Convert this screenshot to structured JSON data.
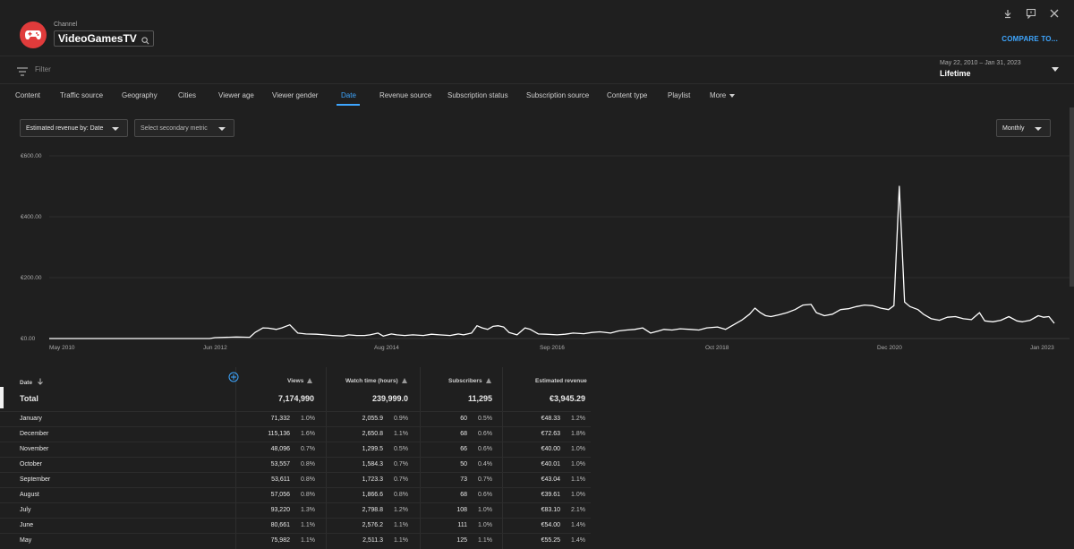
{
  "header": {
    "channel_caption": "Channel",
    "channel_name": "VideoGamesTV",
    "compare_label": "COMPARE TO...",
    "icons": [
      "download-icon",
      "feedback-icon",
      "close-icon",
      "search-icon"
    ]
  },
  "filter": {
    "placeholder": "Filter",
    "date_range": "May 22, 2010 – Jan 31, 2023",
    "date_label": "Lifetime"
  },
  "tabs": [
    {
      "label": "Content"
    },
    {
      "label": "Traffic source"
    },
    {
      "label": "Geography"
    },
    {
      "label": "Cities"
    },
    {
      "label": "Viewer age"
    },
    {
      "label": "Viewer gender"
    },
    {
      "label": "Date",
      "active": true
    },
    {
      "label": "Revenue source"
    },
    {
      "label": "Subscription status"
    },
    {
      "label": "Subscription source"
    },
    {
      "label": "Content type"
    },
    {
      "label": "Playlist"
    },
    {
      "label": "More"
    }
  ],
  "controls": {
    "metric_select": "Estimated revenue by: Date",
    "secondary_select": "Select secondary metric",
    "interval_select": "Monthly"
  },
  "chart_data": {
    "type": "line",
    "ylim": [
      0,
      600
    ],
    "y_ticks": [
      "€600.00",
      "€400.00",
      "€200.00",
      "€0.00"
    ],
    "x_ticks": [
      "May 2010",
      "Jun 2012",
      "Aug 2014",
      "Sep 2016",
      "Oct 2018",
      "Dec 2020",
      "Jan 2023"
    ],
    "grid": true,
    "colors": {
      "line": "#ffffff",
      "grid": "#3a3a3a"
    },
    "points": [
      [
        0,
        0
      ],
      [
        50,
        0
      ],
      [
        60,
        0
      ],
      [
        62,
        3
      ],
      [
        70,
        5
      ],
      [
        75,
        4
      ],
      [
        77,
        20
      ],
      [
        80,
        35
      ],
      [
        82,
        34
      ],
      [
        85,
        30
      ],
      [
        87,
        35
      ],
      [
        90,
        45
      ],
      [
        93,
        18
      ],
      [
        96,
        15
      ],
      [
        100,
        14
      ],
      [
        103,
        12
      ],
      [
        106,
        10
      ],
      [
        110,
        8
      ],
      [
        112,
        12
      ],
      [
        115,
        10
      ],
      [
        118,
        10
      ],
      [
        120,
        12
      ],
      [
        123,
        18
      ],
      [
        125,
        8
      ],
      [
        128,
        15
      ],
      [
        130,
        12
      ],
      [
        133,
        10
      ],
      [
        136,
        12
      ],
      [
        140,
        10
      ],
      [
        143,
        14
      ],
      [
        146,
        12
      ],
      [
        150,
        10
      ],
      [
        153,
        15
      ],
      [
        155,
        12
      ],
      [
        158,
        18
      ],
      [
        160,
        42
      ],
      [
        162,
        35
      ],
      [
        164,
        30
      ],
      [
        166,
        40
      ],
      [
        168,
        42
      ],
      [
        170,
        38
      ],
      [
        172,
        20
      ],
      [
        175,
        12
      ],
      [
        178,
        35
      ],
      [
        180,
        30
      ],
      [
        183,
        15
      ],
      [
        186,
        14
      ],
      [
        190,
        12
      ],
      [
        193,
        14
      ],
      [
        196,
        18
      ],
      [
        200,
        16
      ],
      [
        203,
        20
      ],
      [
        206,
        22
      ],
      [
        210,
        18
      ],
      [
        213,
        25
      ],
      [
        216,
        28
      ],
      [
        219,
        30
      ],
      [
        222,
        35
      ],
      [
        225,
        18
      ],
      [
        228,
        25
      ],
      [
        230,
        30
      ],
      [
        233,
        28
      ],
      [
        236,
        32
      ],
      [
        240,
        30
      ],
      [
        243,
        28
      ],
      [
        246,
        35
      ],
      [
        250,
        38
      ],
      [
        253,
        30
      ],
      [
        256,
        45
      ],
      [
        259,
        60
      ],
      [
        262,
        80
      ],
      [
        264,
        100
      ],
      [
        266,
        85
      ],
      [
        268,
        75
      ],
      [
        270,
        72
      ],
      [
        273,
        78
      ],
      [
        276,
        85
      ],
      [
        279,
        95
      ],
      [
        282,
        110
      ],
      [
        285,
        112
      ],
      [
        287,
        85
      ],
      [
        290,
        75
      ],
      [
        293,
        80
      ],
      [
        296,
        95
      ],
      [
        299,
        98
      ],
      [
        302,
        105
      ],
      [
        305,
        110
      ],
      [
        308,
        108
      ],
      [
        311,
        100
      ],
      [
        314,
        95
      ],
      [
        316,
        108
      ],
      [
        318,
        500
      ],
      [
        320,
        120
      ],
      [
        322,
        105
      ],
      [
        325,
        95
      ],
      [
        327,
        80
      ],
      [
        330,
        65
      ],
      [
        333,
        60
      ],
      [
        336,
        70
      ],
      [
        339,
        72
      ],
      [
        342,
        65
      ],
      [
        345,
        62
      ],
      [
        348,
        85
      ],
      [
        350,
        58
      ],
      [
        353,
        55
      ],
      [
        356,
        60
      ],
      [
        359,
        72
      ],
      [
        362,
        58
      ],
      [
        364,
        55
      ],
      [
        367,
        60
      ],
      [
        370,
        75
      ],
      [
        372,
        70
      ],
      [
        374,
        72
      ],
      [
        376,
        50
      ]
    ]
  },
  "table": {
    "headers": {
      "date": "Date",
      "views": "Views",
      "watch_time": "Watch time (hours)",
      "subscribers": "Subscribers",
      "revenue": "Estimated revenue"
    },
    "total": {
      "label": "Total",
      "views": "7,174,990",
      "watch_time": "239,999.0",
      "subscribers": "11,295",
      "revenue": "€3,945.29"
    },
    "rows": [
      {
        "month": "January",
        "views": "71,332",
        "views_pct": "1.0%",
        "watch": "2,055.9",
        "watch_pct": "0.9%",
        "subs": "60",
        "subs_pct": "0.5%",
        "rev": "€48.33",
        "rev_pct": "1.2%"
      },
      {
        "month": "December",
        "views": "115,136",
        "views_pct": "1.6%",
        "watch": "2,650.8",
        "watch_pct": "1.1%",
        "subs": "68",
        "subs_pct": "0.6%",
        "rev": "€72.63",
        "rev_pct": "1.8%"
      },
      {
        "month": "November",
        "views": "48,096",
        "views_pct": "0.7%",
        "watch": "1,299.5",
        "watch_pct": "0.5%",
        "subs": "66",
        "subs_pct": "0.6%",
        "rev": "€40.00",
        "rev_pct": "1.0%"
      },
      {
        "month": "October",
        "views": "53,557",
        "views_pct": "0.8%",
        "watch": "1,584.3",
        "watch_pct": "0.7%",
        "subs": "50",
        "subs_pct": "0.4%",
        "rev": "€40.01",
        "rev_pct": "1.0%"
      },
      {
        "month": "September",
        "views": "53,611",
        "views_pct": "0.8%",
        "watch": "1,723.3",
        "watch_pct": "0.7%",
        "subs": "73",
        "subs_pct": "0.7%",
        "rev": "€43.04",
        "rev_pct": "1.1%"
      },
      {
        "month": "August",
        "views": "57,056",
        "views_pct": "0.8%",
        "watch": "1,866.6",
        "watch_pct": "0.8%",
        "subs": "68",
        "subs_pct": "0.6%",
        "rev": "€39.61",
        "rev_pct": "1.0%"
      },
      {
        "month": "July",
        "views": "93,220",
        "views_pct": "1.3%",
        "watch": "2,798.8",
        "watch_pct": "1.2%",
        "subs": "108",
        "subs_pct": "1.0%",
        "rev": "€83.10",
        "rev_pct": "2.1%"
      },
      {
        "month": "June",
        "views": "80,661",
        "views_pct": "1.1%",
        "watch": "2,576.2",
        "watch_pct": "1.1%",
        "subs": "111",
        "subs_pct": "1.0%",
        "rev": "€54.00",
        "rev_pct": "1.4%"
      },
      {
        "month": "May",
        "views": "75,982",
        "views_pct": "1.1%",
        "watch": "2,511.3",
        "watch_pct": "1.1%",
        "subs": "125",
        "subs_pct": "1.1%",
        "rev": "€55.25",
        "rev_pct": "1.4%"
      }
    ]
  }
}
